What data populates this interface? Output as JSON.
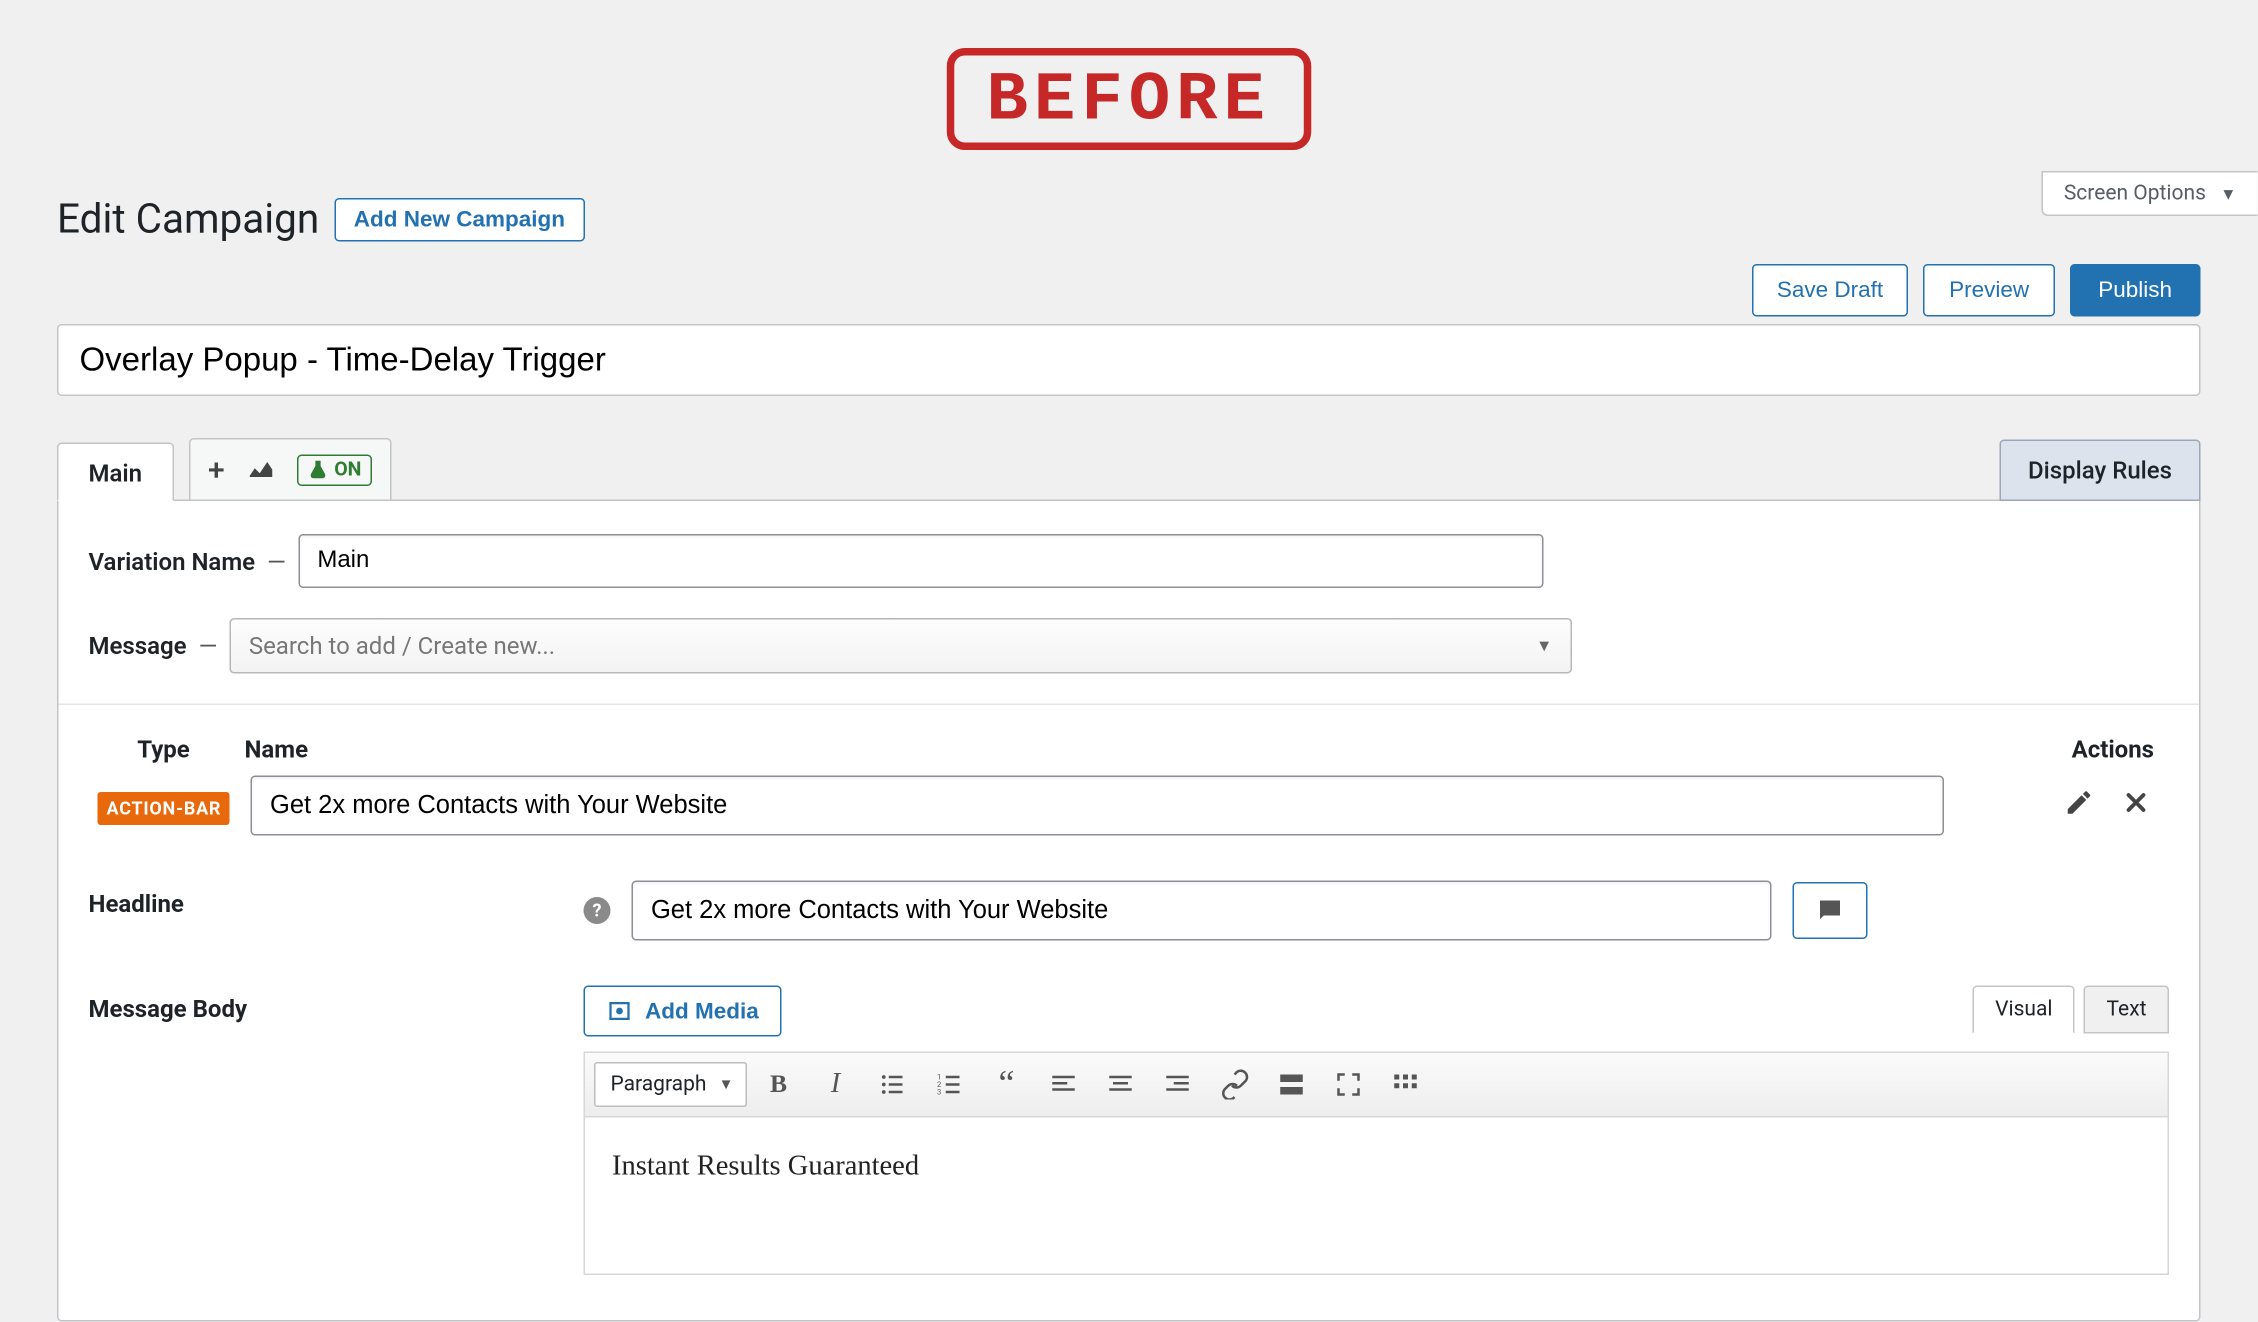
{
  "stamp": "BEFORE",
  "screen_options": "Screen Options",
  "page_title": "Edit Campaign",
  "add_new": "Add New Campaign",
  "buttons": {
    "save_draft": "Save Draft",
    "preview": "Preview",
    "publish": "Publish"
  },
  "title_value": "Overlay Popup - Time-Delay Trigger",
  "tabs": {
    "main": "Main",
    "ab_on": "ON",
    "display_rules": "Display Rules"
  },
  "variation": {
    "label": "Variation Name",
    "value": "Main"
  },
  "message": {
    "label": "Message",
    "placeholder": "Search to add / Create new..."
  },
  "table": {
    "type_header": "Type",
    "name_header": "Name",
    "actions_header": "Actions",
    "row": {
      "type_badge": "ACTION-BAR",
      "name_value": "Get 2x more Contacts with Your Website"
    }
  },
  "headline": {
    "label": "Headline",
    "value": "Get 2x more Contacts with Your Website"
  },
  "body": {
    "label": "Message Body",
    "add_media": "Add Media",
    "editor_tabs": {
      "visual": "Visual",
      "text": "Text"
    },
    "format_select": "Paragraph",
    "content": "Instant Results Guaranteed"
  }
}
